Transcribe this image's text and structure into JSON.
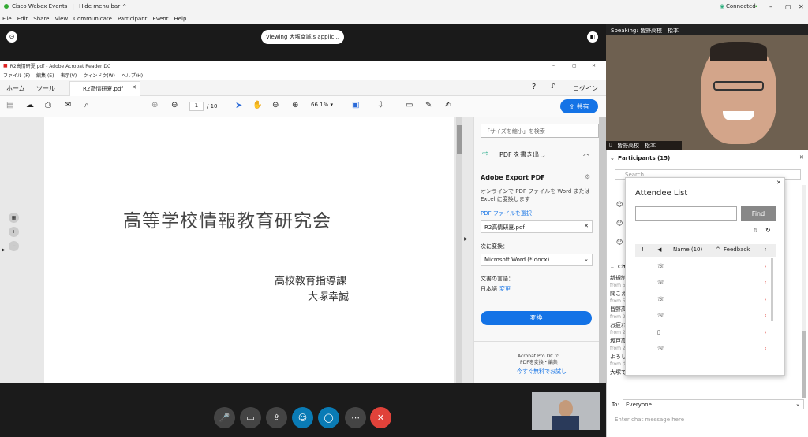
{
  "app": {
    "title": "Cisco Webex Events",
    "hide_menu": "Hide menu bar",
    "status": "Connected"
  },
  "menu": [
    "File",
    "Edit",
    "Share",
    "View",
    "Communicate",
    "Participant",
    "Event",
    "Help"
  ],
  "viewing": "Viewing 大塚幸誠's applic...",
  "acrobat": {
    "title": "R2高情研夏.pdf - Adobe Acrobat Reader DC",
    "menu": [
      "ファイル (F)",
      "編集 (E)",
      "表示(V)",
      "ウィンドウ(W)",
      "ヘルプ(H)"
    ],
    "tabs": [
      "ホーム",
      "ツール",
      "R2高情研夏.pdf"
    ],
    "login": "ログイン",
    "page_current": "1",
    "page_total": "/ 10",
    "zoom": "66.1%",
    "share": "共有",
    "doc_title": "高等学校情報教育研究会",
    "doc_line1": "高校教育指導課",
    "doc_line2": "大塚幸誠",
    "pane": {
      "search_ph": "「サイズを縮小」を検索",
      "export": "PDF を書き出し",
      "export_title": "Adobe Export PDF",
      "desc": "オンラインで PDF ファイルを Word または Excel に変換します",
      "select": "PDF ファイルを選択",
      "file": "R2高情研夏.pdf",
      "convert_to": "次に変換：",
      "format": "Microsoft Word (*.docx)",
      "lang_label": "文書の言語：",
      "lang": "日本語",
      "change": "変更",
      "convert_btn": "変換",
      "promo1": "Acrobat Pro DC で",
      "promo2": "PDFを変換・編集",
      "promo3": "今すぐ無料でお試し"
    }
  },
  "video": {
    "speaking": "Speaking: 皆野高校　松本",
    "name": "皆野高校　松本"
  },
  "participants": {
    "header": "Participants (15)",
    "search_ph": "Search"
  },
  "attendee": {
    "title": "Attendee List",
    "find": "Find",
    "col_name": "Name (10)",
    "col_feedback": "Feedback"
  },
  "chat": {
    "header": "Ch",
    "messages": [
      {
        "text": "新規制",
        "from": "from 5"
      },
      {
        "text": "聞こえ",
        "from": "from 5"
      },
      {
        "text": "皆野高",
        "from": "from 2"
      },
      {
        "text": "お疲れ",
        "from": "from 2"
      },
      {
        "text": "坂戸高",
        "from": "from 2"
      },
      {
        "text": "よろし",
        "from": "from ナ"
      },
      {
        "text": "大塚で",
        "from": ""
      }
    ],
    "to_label": "To:",
    "to_value": "Everyone",
    "input_ph": "Enter chat message here"
  }
}
